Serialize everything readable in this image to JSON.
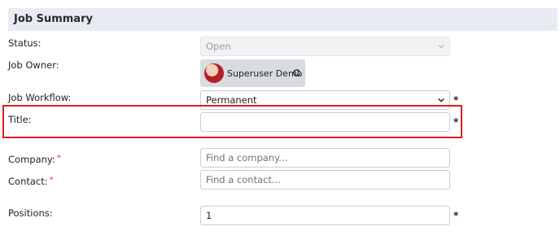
{
  "section": {
    "title": "Job Summary"
  },
  "fields": {
    "status": {
      "label": "Status:",
      "value": "Open"
    },
    "job_owner": {
      "label": "Job Owner:",
      "name": "Superuser Demo"
    },
    "job_workflow": {
      "label": "Job Workflow:",
      "value": "Permanent",
      "required_mark": "*"
    },
    "title": {
      "label": "Title:",
      "value": "",
      "required_mark": "*"
    },
    "company": {
      "label": "Company:",
      "required_mark": "*",
      "placeholder": "Find a company..."
    },
    "contact": {
      "label": "Contact:",
      "required_mark": "*",
      "placeholder": "Find a contact..."
    },
    "positions": {
      "label": "Positions:",
      "value": "1",
      "required_mark": "*"
    }
  },
  "colors": {
    "header_bg": "#e8ebf2",
    "highlight_border": "#e01d1d",
    "required_red": "#e03030"
  },
  "icons": {
    "refresh": "refresh-icon",
    "dropdown": "chevron-down-icon"
  }
}
